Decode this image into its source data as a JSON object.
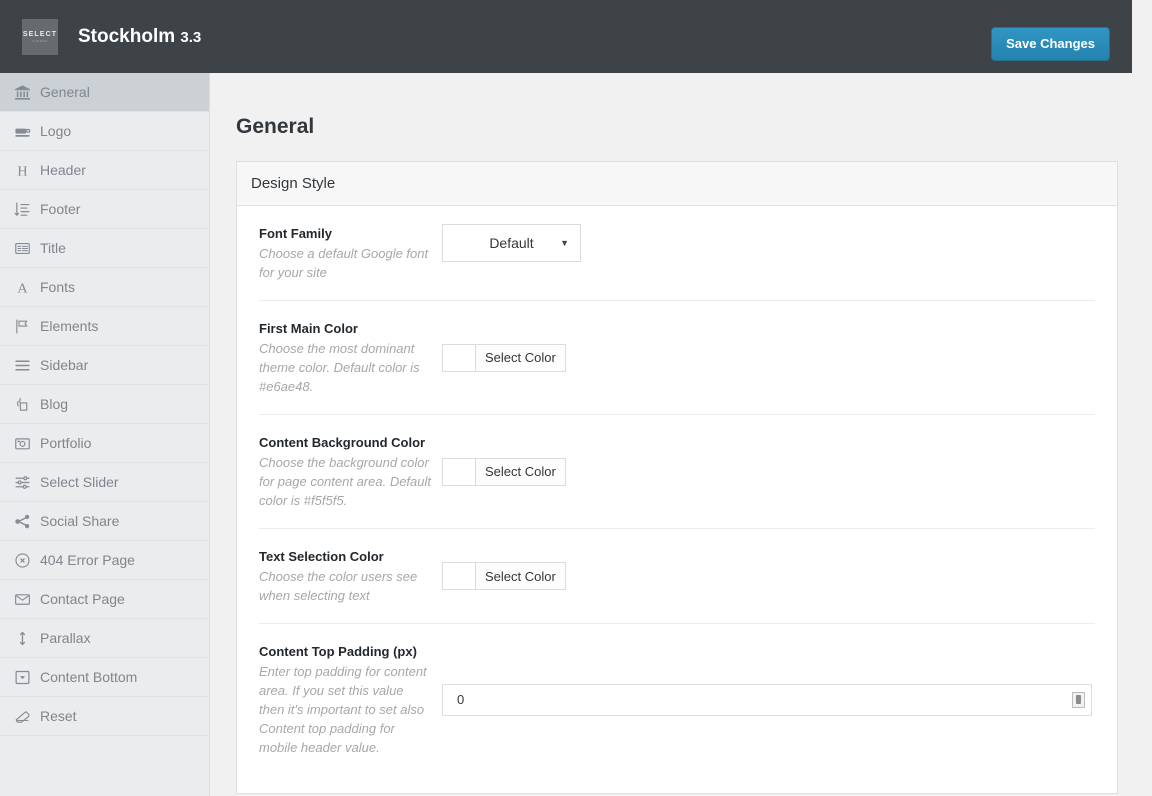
{
  "topbar": {
    "logo_text": "SELECT",
    "logo_subtext": "THEMES",
    "title": "Stockholm",
    "version": "3.3",
    "save_label": "Save Changes",
    "bg_color": "#3e4347",
    "accent_color": "#2b8ab8"
  },
  "sidebar": {
    "items": [
      {
        "label": "General",
        "icon": "bank-icon",
        "active": true
      },
      {
        "label": "Logo",
        "icon": "logo-stamp-icon",
        "active": false
      },
      {
        "label": "Header",
        "icon": "heading-h-icon",
        "active": false
      },
      {
        "label": "Footer",
        "icon": "sort-list-icon",
        "active": false
      },
      {
        "label": "Title",
        "icon": "text-block-icon",
        "active": false
      },
      {
        "label": "Fonts",
        "icon": "letter-a-icon",
        "active": false
      },
      {
        "label": "Elements",
        "icon": "flag-icon",
        "active": false
      },
      {
        "label": "Sidebar",
        "icon": "menu-lines-icon",
        "active": false
      },
      {
        "label": "Blog",
        "icon": "copy-pages-icon",
        "active": false
      },
      {
        "label": "Portfolio",
        "icon": "camera-icon",
        "active": false
      },
      {
        "label": "Select Slider",
        "icon": "sliders-icon",
        "active": false
      },
      {
        "label": "Social Share",
        "icon": "share-nodes-icon",
        "active": false
      },
      {
        "label": "404 Error Page",
        "icon": "error-circle-icon",
        "active": false
      },
      {
        "label": "Contact Page",
        "icon": "envelope-icon",
        "active": false
      },
      {
        "label": "Parallax",
        "icon": "arrows-vertical-icon",
        "active": false
      },
      {
        "label": "Content Bottom",
        "icon": "box-caret-down-icon",
        "active": false
      },
      {
        "label": "Reset",
        "icon": "eraser-icon",
        "active": false
      }
    ]
  },
  "main": {
    "page_title": "General",
    "panel": {
      "heading": "Design Style",
      "fields": [
        {
          "title": "Font Family",
          "desc": "Choose a default Google font for your site",
          "control": "select",
          "value": "Default",
          "caret": "▼"
        },
        {
          "title": "First Main Color",
          "desc": "Choose the most dominant theme color. Default color is #e6ae48.",
          "control": "color",
          "button_label": "Select Color",
          "swatch_color": "#ffffff"
        },
        {
          "title": "Content Background Color",
          "desc": "Choose the background color for page content area. Default color is #f5f5f5.",
          "control": "color",
          "button_label": "Select Color",
          "swatch_color": "#ffffff"
        },
        {
          "title": "Text Selection Color",
          "desc": "Choose the color users see when selecting text",
          "control": "color",
          "button_label": "Select Color",
          "swatch_color": "#ffffff"
        },
        {
          "title": "Content Top Padding (px)",
          "desc": "Enter top padding for content area. If you set this value then it's important to set also Content top padding for mobile header value.",
          "control": "text",
          "value": "0",
          "placeholder": ""
        }
      ]
    }
  }
}
